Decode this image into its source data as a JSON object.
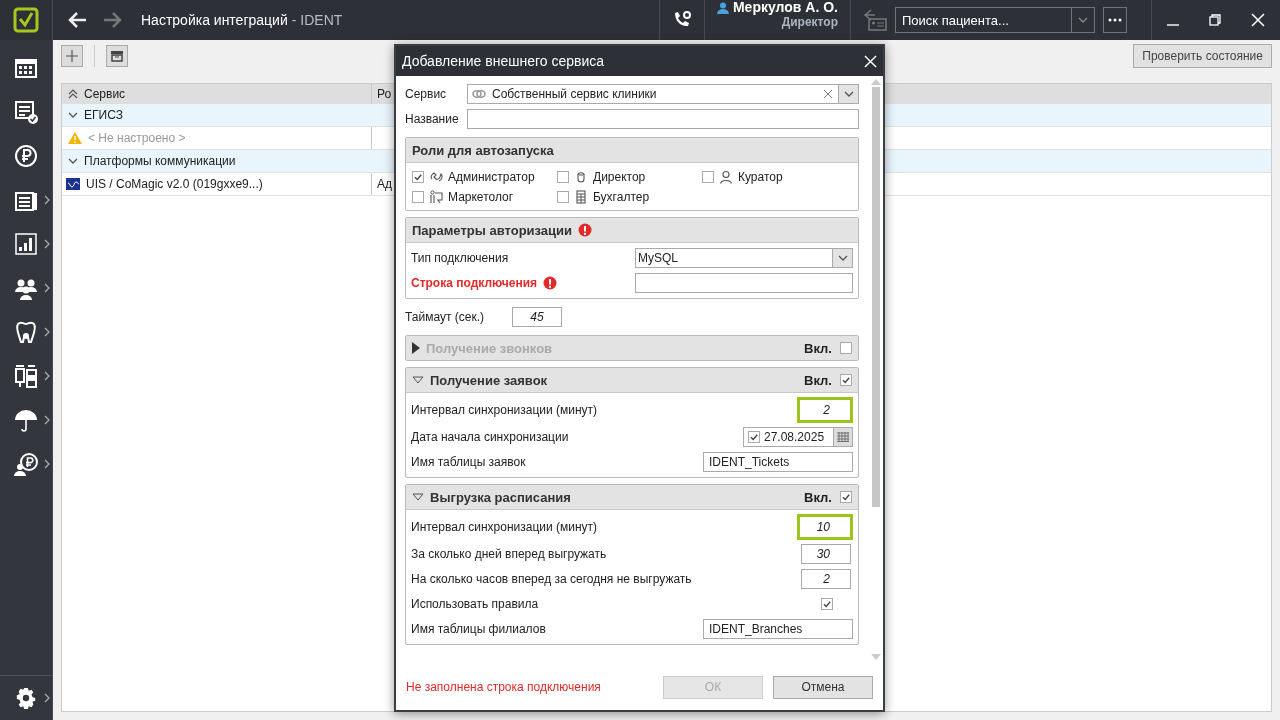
{
  "window": {
    "title": "Настройка интеграций",
    "subtitle": "- IDENT"
  },
  "user": {
    "name": "Меркулов А. О.",
    "role": "Директор"
  },
  "search": {
    "placeholder": "Поиск пациента..."
  },
  "toolbar": {
    "check_button": "Проверить состояние"
  },
  "table": {
    "columns": [
      "Сервис",
      "Ро"
    ],
    "rows": [
      {
        "kind": "group",
        "label": "ЕГИСЗ",
        "expanded": true
      },
      {
        "kind": "warning",
        "cells": [
          "< Не настроено >",
          ""
        ]
      },
      {
        "kind": "group",
        "label": "Платформы коммуникации",
        "expanded": true
      },
      {
        "kind": "service",
        "cells": [
          "UIS / CoMagic v2.0 (019gxxe9...)",
          "Ад"
        ]
      }
    ]
  },
  "dialog": {
    "title": "Добавление внешнего сервиса",
    "service": {
      "label": "Сервис",
      "value": "Собственный сервис клиники"
    },
    "name": {
      "label": "Название"
    },
    "roles": {
      "title": "Роли для автозапуска",
      "items": [
        {
          "label": "Администратор",
          "checked": true
        },
        {
          "label": "Директор",
          "checked": false
        },
        {
          "label": "Куратор",
          "checked": false
        },
        {
          "label": "Маркетолог",
          "checked": false
        },
        {
          "label": "Бухгалтер",
          "checked": false
        }
      ]
    },
    "auth": {
      "title": "Параметры авторизации",
      "error": true,
      "type": {
        "label": "Тип подключения",
        "value": "MySQL"
      },
      "connection": {
        "label": "Строка подключения",
        "error": true
      }
    },
    "timeout": {
      "label": "Таймаут (сек.)",
      "value": "45"
    },
    "sections": [
      {
        "title": "Получение звонков",
        "expanded": false,
        "enabled": false,
        "toggle_label": "Вкл."
      },
      {
        "title": "Получение заявок",
        "expanded": true,
        "enabled": true,
        "toggle_label": "Вкл.",
        "rows": [
          {
            "kind": "number",
            "label": "Интервал синхронизации (минут)",
            "value": "2",
            "highlighted": true
          },
          {
            "kind": "date",
            "label": "Дата начала синхронизации",
            "value": "27.08.2025",
            "checked": true
          },
          {
            "kind": "text",
            "label": "Имя таблицы заявок",
            "value": "IDENT_Tickets"
          }
        ]
      },
      {
        "title": "Выгрузка расписания",
        "expanded": true,
        "enabled": true,
        "toggle_label": "Вкл.",
        "rows": [
          {
            "kind": "number",
            "label": "Интервал синхронизации (минут)",
            "value": "10",
            "highlighted": true
          },
          {
            "kind": "number",
            "label": "За сколько дней вперед выгружать",
            "value": "30",
            "highlighted": false
          },
          {
            "kind": "number",
            "label": "На сколько часов вперед за сегодня не выгружать",
            "value": "2",
            "highlighted": false
          },
          {
            "kind": "check",
            "label": "Использовать правила",
            "checked": true
          },
          {
            "kind": "text",
            "label": "Имя таблицы филиалов",
            "value": "IDENT_Branches"
          }
        ]
      }
    ],
    "error_message": "Не заполнена строка подключения",
    "buttons": [
      {
        "label": "ОК",
        "disabled": true
      },
      {
        "label": "Отмена",
        "disabled": false
      }
    ]
  }
}
